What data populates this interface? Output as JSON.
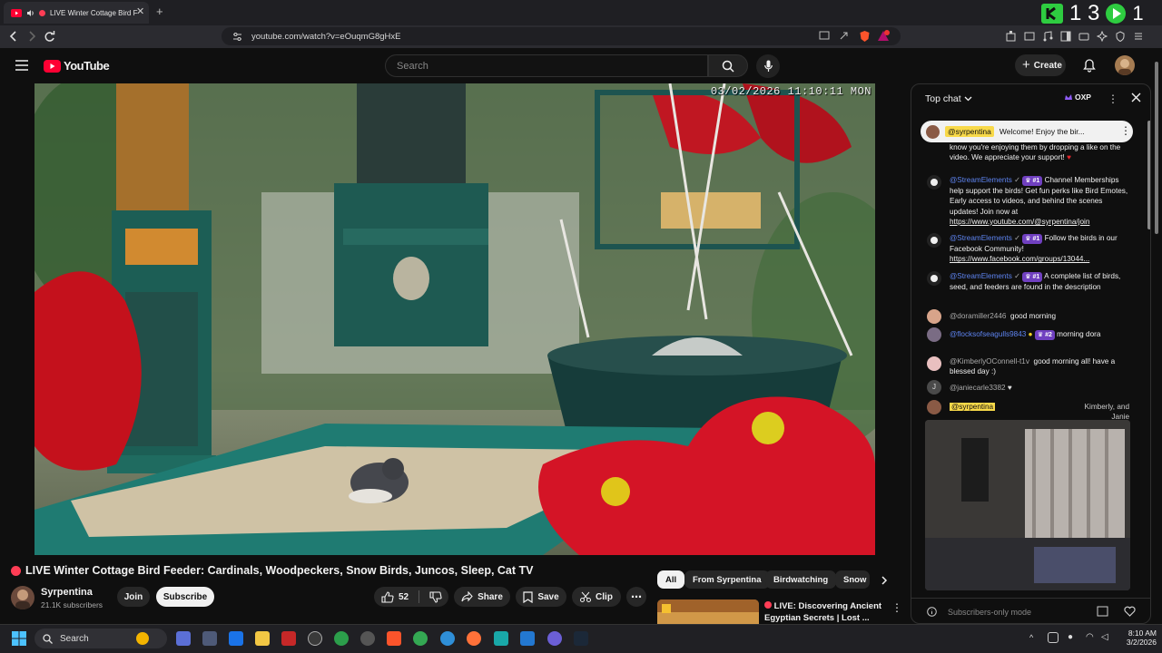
{
  "browser": {
    "tab_title": "LIVE Winter Cottage Bird F",
    "url": "youtube.com/watch?v=eOuqmG8gHxE",
    "extension_counter": "1 3",
    "extension_counter2": "1"
  },
  "youtube": {
    "logo_text": "YouTube",
    "search_placeholder": "Search",
    "create_label": "Create"
  },
  "video": {
    "timestamp": "03/02/2026 11:10:11 MON",
    "title": "LIVE Winter Cottage Bird Feeder: Cardinals, Woodpeckers, Snow Birds, Juncos, Sleep, Cat TV",
    "channel": "Syrpentina",
    "subscribers": "21.1K subscribers",
    "join_label": "Join",
    "subscribe_label": "Subscribe",
    "likes": "52",
    "share_label": "Share",
    "save_label": "Save",
    "clip_label": "Clip"
  },
  "chat": {
    "header": "Top chat",
    "oxp_label": "OXP",
    "pinned_author": "@syrpentina",
    "pinned_text": "Welcome! Enjoy the bir...",
    "pinned_cont": "know you're enjoying them by dropping a like on the video. We appreciate your support!",
    "messages": [
      {
        "author": "@StreamElements",
        "badge": "#1",
        "text": "Channel Memberships help support the birds! Get fun perks like Bird Emotes, Early access to videos, and behind the scenes updates! Join now at ",
        "link": "https://www.youtube.com/@syrpentina/join"
      },
      {
        "author": "@StreamElements",
        "badge": "#1",
        "text": "Follow the birds in our Facebook Community! ",
        "link": "https://www.facebook.com/groups/13044..."
      },
      {
        "author": "@StreamElements",
        "badge": "#1",
        "text": "A complete list of birds, seed, and feeders are found in the description",
        "link": ""
      },
      {
        "author": "@doramiller2446",
        "badge": "",
        "text": "good morning",
        "link": ""
      },
      {
        "author": "@flocksofseagulls9843",
        "badge": "#2",
        "text": "morning dora",
        "link": ""
      },
      {
        "author": "@KimberlyOConnell-t1v",
        "badge": "",
        "text": "good morning all! have a blessed day :)",
        "link": ""
      },
      {
        "author": "@janiecarle3382",
        "badge": "",
        "text": "",
        "link": ""
      },
      {
        "author": "@syrpentina",
        "badge": "",
        "text": "Kimberly, and Janie",
        "link": ""
      }
    ],
    "input_placeholder": "Subscribers-only mode"
  },
  "recommendations": {
    "chips": [
      "All",
      "From Syrpentina",
      "Birdwatching",
      "Snow"
    ],
    "next_title_line1": "LIVE: Discovering Ancient",
    "next_title_line2": "Egyptian Secrets | Lost ..."
  },
  "taskbar": {
    "search_label": "Search",
    "time": "8:10 AM",
    "date": "3/2/2026"
  },
  "colors": {
    "youtube_red": "#ff0033",
    "live_red": "#ff3d55",
    "member_purple": "#7040c0",
    "moderator_blue": "#5e84f1",
    "extension_green": "#2ecc40"
  }
}
